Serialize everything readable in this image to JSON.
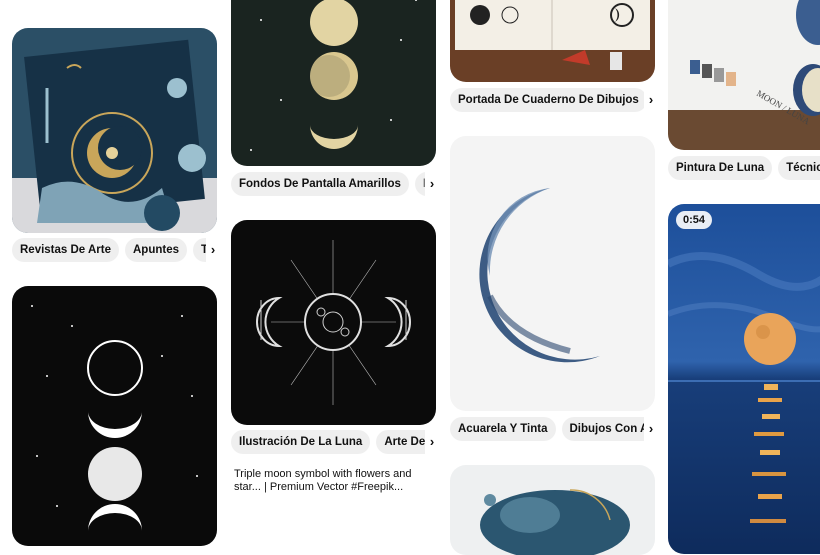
{
  "colors": {
    "chip_bg": "#efefef",
    "text": "#111111",
    "page_bg": "#ffffff"
  },
  "columns": [
    {
      "pins": [
        {
          "image": "watercolor moon art journal page, navy and gold",
          "chips": [
            "Revistas De Arte",
            "Apuntes",
            "Técn"
          ]
        },
        {
          "image": "moon phases on starry black background"
        }
      ]
    },
    {
      "pins": [
        {
          "image": "gold moon phases on dark green starry background",
          "chips": [
            "Fondos De Pantalla Amarillos",
            "Mar"
          ]
        },
        {
          "image": "triple moon symbol with flowers and stars",
          "chips": [
            "Ilustración De La Luna",
            "Arte De Lu"
          ],
          "description": "Triple moon symbol with flowers and star... | Premium Vector #Freepik..."
        }
      ]
    },
    {
      "pins": [
        {
          "image": "sketchbook with moon drawings",
          "chips": [
            "Portada De Cuaderno De Dibujos",
            "|"
          ]
        },
        {
          "image": "watercolor blue crescent moon",
          "chips": [
            "Acuarela Y Tinta",
            "Dibujos Con Acu"
          ]
        },
        {
          "image": "blue watercolor galaxy painting"
        }
      ]
    },
    {
      "pins": [
        {
          "image": "moon luna watercolor paint swatches",
          "chips": [
            "Pintura De Luna",
            "Técnicas"
          ]
        },
        {
          "image": "full moon over the sea at night",
          "badge": "0:54"
        }
      ]
    }
  ],
  "icons": {
    "chips_scroll": "chevron-right-icon"
  },
  "arrow_glyph": "›"
}
